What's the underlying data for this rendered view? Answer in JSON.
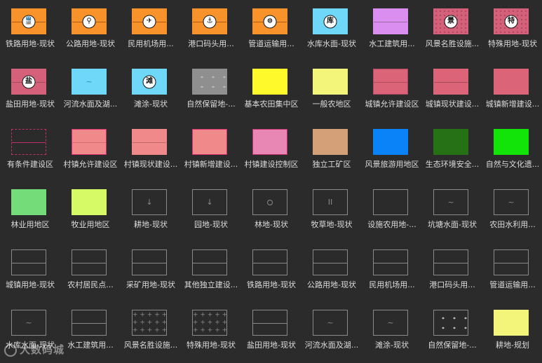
{
  "legend": {
    "items": [
      {
        "label": "铁路用地-现状",
        "fill": "#f7932a",
        "border": "#f7932a",
        "line": "#b05a10",
        "symbol": "train-icon"
      },
      {
        "label": "公路用地-现状",
        "fill": "#f7932a",
        "border": "#f7932a",
        "line": "#b05a10",
        "symbol": "road-icon"
      },
      {
        "label": "民用机场用...",
        "fill": "#f7932a",
        "border": "#f7932a",
        "line": "#b05a10",
        "symbol": "airplane-icon"
      },
      {
        "label": "港口码头用...",
        "fill": "#f7932a",
        "border": "#f7932a",
        "line": "#b05a10",
        "symbol": "anchor-icon"
      },
      {
        "label": "管道运输用...",
        "fill": "#f7932a",
        "border": "#f7932a",
        "line": "#b05a10",
        "symbol": "pipeline-icon"
      },
      {
        "label": "水库水面-现状",
        "fill": "#6fd7f7",
        "border": "#6fd7f7",
        "symbol": "reservoir-icon",
        "symbol_text": "库"
      },
      {
        "label": "水工建筑用...",
        "fill": "#d98ef0",
        "border": "#d98ef0",
        "line": "#9a6aa8",
        "pattern": "hline"
      },
      {
        "label": "风景名胜设施...",
        "fill": "#d4607a",
        "border": "#d4607a",
        "symbol": "scenic-icon",
        "symbol_text": "景",
        "pattern": "dots",
        "dot_color": "#b04a64"
      },
      {
        "label": "特殊用地-现状",
        "fill": "#d4607a",
        "border": "#d4607a",
        "symbol": "special-icon",
        "symbol_text": "特",
        "pattern": "dots",
        "dot_color": "#b04a64"
      },
      {
        "label": "盐田用地-现状",
        "fill": "#d4607a",
        "border": "#d4607a",
        "line": "#a24a60",
        "symbol": "salt-icon",
        "symbol_text": "盐"
      },
      {
        "label": "河流水面及湖...",
        "fill": "#6fd7f7",
        "border": "#6fd7f7",
        "glyph": "~",
        "glyph_color": "#3a8aa8"
      },
      {
        "label": "滩涂-现状",
        "fill": "#6fd7f7",
        "border": "#6fd7f7",
        "symbol": "tidal-icon",
        "symbol_text": "滩"
      },
      {
        "label": "自然保留地-...",
        "fill": "#8f8f8f",
        "border": "#8f8f8f",
        "pattern": "dots4",
        "dot_color": "#b8b8b8"
      },
      {
        "label": "基本农田集中区",
        "fill": "#fdf92a",
        "border": "#fdf92a"
      },
      {
        "label": "一般农地区",
        "fill": "#f2f57a",
        "border": "#f2f57a"
      },
      {
        "label": "城镇允许建设区",
        "fill": "#dc6478",
        "border": "#b04a60",
        "line": "#b04a60",
        "pattern": "hline"
      },
      {
        "label": "城镇现状建设...",
        "fill": "#dc6478",
        "border": "#dc6478",
        "line": "#a04a5a",
        "pattern": "hline"
      },
      {
        "label": "城镇新增建设...",
        "fill": "#dc6478",
        "border": "#dc6478"
      },
      {
        "label": "有条件建设区",
        "fill": "#2b2b2b",
        "border": "#c0306a",
        "dashed": true,
        "line": "#c0306a",
        "pattern": "hline"
      },
      {
        "label": "村镇允许建设区",
        "fill": "#f08a8a",
        "border": "#d43070",
        "line": "#d86a72",
        "pattern": "hline"
      },
      {
        "label": "村镇现状建设...",
        "fill": "#f08a8a",
        "border": "#f08a8a",
        "line": "#c06a6a",
        "pattern": "hline"
      },
      {
        "label": "村镇新增建设...",
        "fill": "#f08a8a",
        "border": "#d43070"
      },
      {
        "label": "村镇建设控制区",
        "fill": "#e886b4",
        "border": "#c0306a"
      },
      {
        "label": "独立工矿区",
        "fill": "#d4a078",
        "border": "#d4a078"
      },
      {
        "label": "风景旅游用地区",
        "fill": "#0a82f8",
        "border": "#0a82f8"
      },
      {
        "label": "生态环境安全...",
        "fill": "#267016",
        "border": "#267016"
      },
      {
        "label": "自然与文化遗...",
        "fill": "#12e40a",
        "border": "#12e40a"
      },
      {
        "label": "林业用地区",
        "fill": "#74dc78",
        "border": "#74dc78"
      },
      {
        "label": "牧业用地区",
        "fill": "#d6fa66",
        "border": "#d6fa66"
      },
      {
        "label": "耕地-现状",
        "fill": "#2b2b2b",
        "border": "#8a8a8a",
        "glyph": "↓",
        "glyph_color": "#8a8a8a"
      },
      {
        "label": "园地-现状",
        "fill": "#2b2b2b",
        "border": "#8a8a8a",
        "glyph": "↓",
        "glyph_color": "#8a8a8a"
      },
      {
        "label": "林地-现状",
        "fill": "#2b2b2b",
        "border": "#8a8a8a",
        "pattern": "circle"
      },
      {
        "label": "牧草地-现状",
        "fill": "#2b2b2b",
        "border": "#8a8a8a",
        "glyph": "II",
        "glyph_color": "#8a8a8a"
      },
      {
        "label": "设施农用地-...",
        "fill": "#2b2b2b",
        "border": "#8a8a8a"
      },
      {
        "label": "坑塘水面-现状",
        "fill": "#2b2b2b",
        "border": "#8a8a8a",
        "glyph": "~",
        "glyph_color": "#8a8a8a"
      },
      {
        "label": "农田水利用...",
        "fill": "#2b2b2b",
        "border": "#8a8a8a",
        "glyph": "~",
        "glyph_color": "#8a8a8a"
      },
      {
        "label": "城镇用地-现状",
        "fill": "#2b2b2b",
        "border": "#8a8a8a",
        "line": "#8a8a8a",
        "pattern": "hline"
      },
      {
        "label": "农村居民点...",
        "fill": "#2b2b2b",
        "border": "#8a8a8a",
        "line": "#8a8a8a",
        "pattern": "hline"
      },
      {
        "label": "采矿用地-现状",
        "fill": "#2b2b2b",
        "border": "#8a8a8a",
        "line": "#8a8a8a",
        "pattern": "hline"
      },
      {
        "label": "其他独立建设...",
        "fill": "#2b2b2b",
        "border": "#8a8a8a",
        "line": "#8a8a8a",
        "pattern": "hline"
      },
      {
        "label": "铁路用地-现状",
        "fill": "#2b2b2b",
        "border": "#8a8a8a",
        "line": "#8a8a8a",
        "pattern": "hline"
      },
      {
        "label": "公路用地-现状",
        "fill": "#2b2b2b",
        "border": "#8a8a8a",
        "line": "#8a8a8a",
        "pattern": "hline"
      },
      {
        "label": "民用机场用...",
        "fill": "#2b2b2b",
        "border": "#8a8a8a",
        "line": "#8a8a8a",
        "pattern": "hline"
      },
      {
        "label": "港口码头用...",
        "fill": "#2b2b2b",
        "border": "#8a8a8a",
        "line": "#8a8a8a",
        "pattern": "hline"
      },
      {
        "label": "管道运输用...",
        "fill": "#2b2b2b",
        "border": "#8a8a8a",
        "line": "#8a8a8a",
        "pattern": "hline"
      },
      {
        "label": "水库水面-现状",
        "fill": "#2b2b2b",
        "border": "#8a8a8a",
        "glyph": "~",
        "glyph_color": "#8a8a8a"
      },
      {
        "label": "水工建筑用...",
        "fill": "#2b2b2b",
        "border": "#8a8a8a",
        "line": "#8a8a8a",
        "pattern": "hline"
      },
      {
        "label": "风景名胜设施...",
        "fill": "#2b2b2b",
        "border": "#8a8a8a",
        "glyph": "+ + + + +\n+ + + + +\n+ + + + +",
        "glyph_color": "#8a8a8a",
        "pattern": "plusgrid"
      },
      {
        "label": "特殊用地-现状",
        "fill": "#2b2b2b",
        "border": "#8a8a8a",
        "glyph": "+ + + + +\n+ + + + +\n+ + + + +",
        "glyph_color": "#8a8a8a",
        "pattern": "plusgrid"
      },
      {
        "label": "盐田用地-现状",
        "fill": "#2b2b2b",
        "border": "#8a8a8a",
        "line": "#8a8a8a",
        "pattern": "hline"
      },
      {
        "label": "河流水面及湖...",
        "fill": "#2b2b2b",
        "border": "#8a8a8a",
        "glyph": "~",
        "glyph_color": "#8a8a8a"
      },
      {
        "label": "滩涂-现状",
        "fill": "#2b2b2b",
        "border": "#8a8a8a",
        "glyph": "~",
        "glyph_color": "#8a8a8a"
      },
      {
        "label": "自然保留地-...",
        "fill": "#2b2b2b",
        "border": "#8a8a8a",
        "pattern": "dots4",
        "dot_color": "#b8b8b8"
      },
      {
        "label": "耕地-规划",
        "fill": "#f2f57a",
        "border": "#f2f57a"
      }
    ]
  },
  "watermark": {
    "text": "大数码城"
  }
}
